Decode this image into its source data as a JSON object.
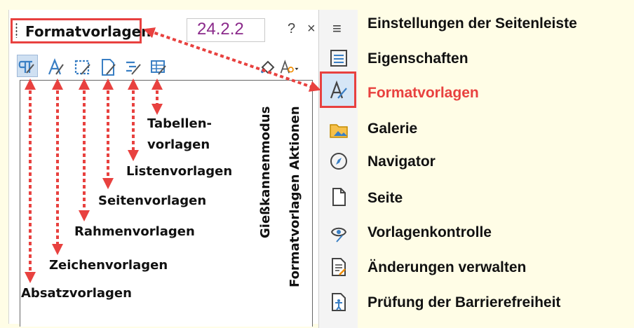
{
  "panel": {
    "title": "Formatvorlagen",
    "version": "24.2.2",
    "help_label": "?",
    "close_label": "×",
    "menu_label": "≡"
  },
  "toolbar": {
    "icons": [
      "paragraph-styles-icon",
      "character-styles-icon",
      "frame-styles-icon",
      "page-styles-icon",
      "list-styles-icon",
      "table-styles-icon",
      "fill-format-mode-icon",
      "styles-actions-icon"
    ]
  },
  "annotations": {
    "table_styles_1": "Tabellen-",
    "table_styles_2": "vorlagen",
    "list_styles": "Listenvorlagen",
    "page_styles": "Seitenvorlagen",
    "frame_styles": "Rahmenvorlagen",
    "character_styles": "Zeichenvorlagen",
    "paragraph_styles": "Absatzvorlagen",
    "fill_format_mode": "Gießkannenmodus",
    "styles_actions": "Formatvorlagen Aktionen"
  },
  "sidebar": {
    "items": [
      {
        "label": "Einstellungen der Seitenleiste",
        "icon": "menu-icon"
      },
      {
        "label": "Eigenschaften",
        "icon": "properties-icon"
      },
      {
        "label": "Formatvorlagen",
        "icon": "styles-icon",
        "active": true
      },
      {
        "label": "Galerie",
        "icon": "gallery-icon"
      },
      {
        "label": "Navigator",
        "icon": "navigator-icon"
      },
      {
        "label": "Seite",
        "icon": "page-icon"
      },
      {
        "label": "Vorlagenkontrolle",
        "icon": "style-inspector-icon"
      },
      {
        "label": "Änderungen verwalten",
        "icon": "manage-changes-icon"
      },
      {
        "label": "Prüfung der Barrierefreiheit",
        "icon": "accessibility-check-icon"
      }
    ]
  },
  "colors": {
    "accent": "#e8413f",
    "version_text": "#8b2a8b",
    "background": "#fffde6",
    "icon_blue": "#3a7fc4"
  }
}
